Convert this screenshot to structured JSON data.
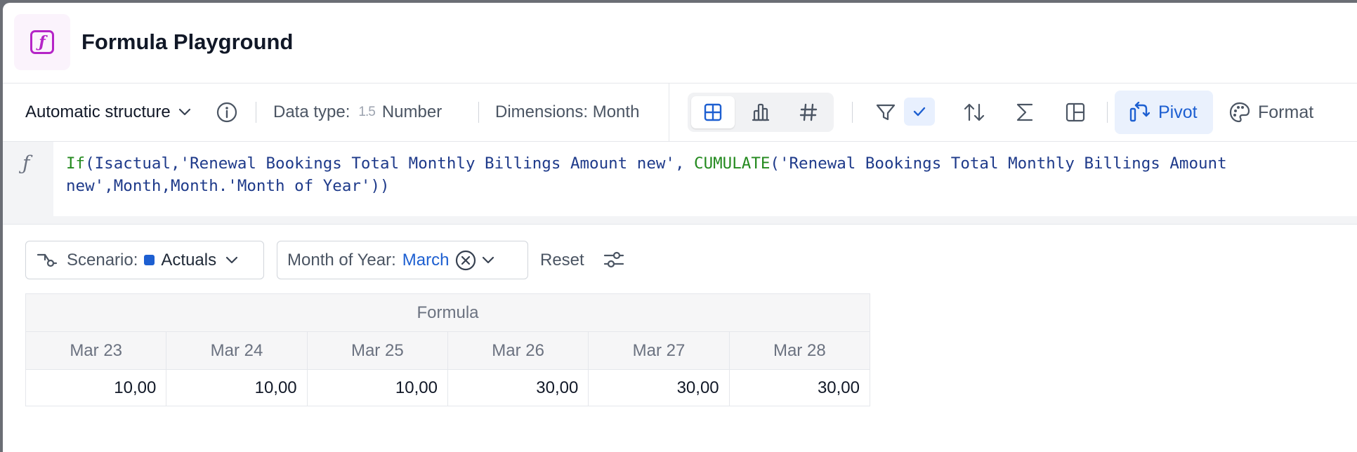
{
  "header": {
    "title": "Formula Playground",
    "icon": "formula-icon"
  },
  "toolbar": {
    "structure_label": "Automatic structure",
    "data_type_label": "Data type:",
    "data_type_glyph": "1.5",
    "data_type_value": "Number",
    "dimensions_label": "Dimensions: Month",
    "view_modes": [
      "table-view-icon",
      "chart-view-icon",
      "number-view-icon"
    ],
    "active_view": "table",
    "pivot_label": "Pivot",
    "format_label": "Format"
  },
  "formula": {
    "fx_glyph": "ƒ",
    "parts": {
      "fn1": "If",
      "args1": "(Isactual,'Renewal Bookings Total Monthly Billings Amount new', ",
      "fn2": "CUMULATE",
      "args2": "('Renewal Bookings Total Monthly Billings Amount new',Month,Month.'Month of Year'))"
    }
  },
  "filters": {
    "scenario_label": "Scenario:",
    "scenario_value": "Actuals",
    "scenario_color": "#1d5fd1",
    "month_label": "Month of Year:",
    "month_value": "March",
    "reset_label": "Reset"
  },
  "table": {
    "group_header": "Formula",
    "columns": [
      "Mar 23",
      "Mar 24",
      "Mar 25",
      "Mar 26",
      "Mar 27",
      "Mar 28"
    ],
    "values": [
      "10,00",
      "10,00",
      "10,00",
      "30,00",
      "30,00",
      "30,00"
    ]
  },
  "colors": {
    "accent": "#1d5fd1",
    "brand": "#b524c7",
    "keyword": "#248a1f"
  }
}
